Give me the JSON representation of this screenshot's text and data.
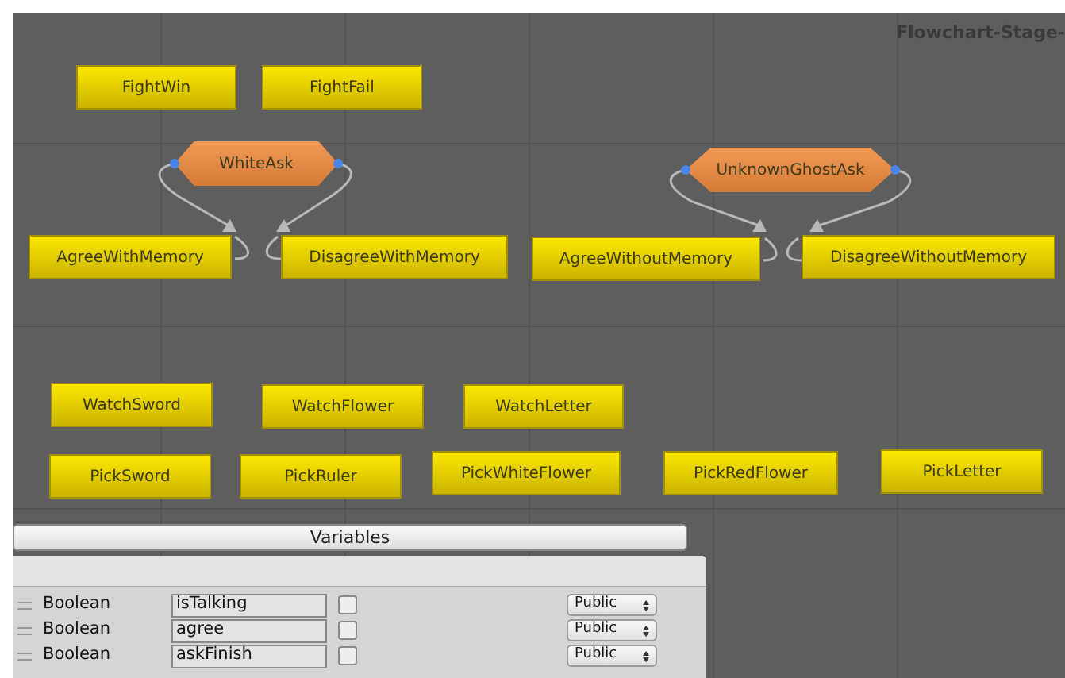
{
  "flowchart": {
    "title": "Flowchart-Stage-"
  },
  "nodes": [
    {
      "kind": "block",
      "label": "FightWin"
    },
    {
      "kind": "block",
      "label": "FightFail"
    },
    {
      "kind": "event",
      "label": "WhiteAsk"
    },
    {
      "kind": "block",
      "label": "AgreeWithMemory"
    },
    {
      "kind": "block",
      "label": "DisagreeWithMemory"
    },
    {
      "kind": "event",
      "label": "UnknownGhostAsk"
    },
    {
      "kind": "block",
      "label": "AgreeWithoutMemory"
    },
    {
      "kind": "block",
      "label": "DisagreeWithoutMemory"
    },
    {
      "kind": "block",
      "label": "WatchSword"
    },
    {
      "kind": "block",
      "label": "WatchFlower"
    },
    {
      "kind": "block",
      "label": "WatchLetter"
    },
    {
      "kind": "block",
      "label": "PickSword"
    },
    {
      "kind": "block",
      "label": "PickRuler"
    },
    {
      "kind": "block",
      "label": "PickWhiteFlower"
    },
    {
      "kind": "block",
      "label": "PickRedFlower"
    },
    {
      "kind": "block",
      "label": "PickLetter"
    }
  ],
  "variables": {
    "button": "Variables",
    "rows": [
      {
        "type": "Boolean",
        "name": "isTalking",
        "checked": false,
        "access": "Public"
      },
      {
        "type": "Boolean",
        "name": "agree",
        "checked": false,
        "access": "Public"
      },
      {
        "type": "Boolean",
        "name": "askFinish",
        "checked": false,
        "access": "Public"
      }
    ]
  }
}
